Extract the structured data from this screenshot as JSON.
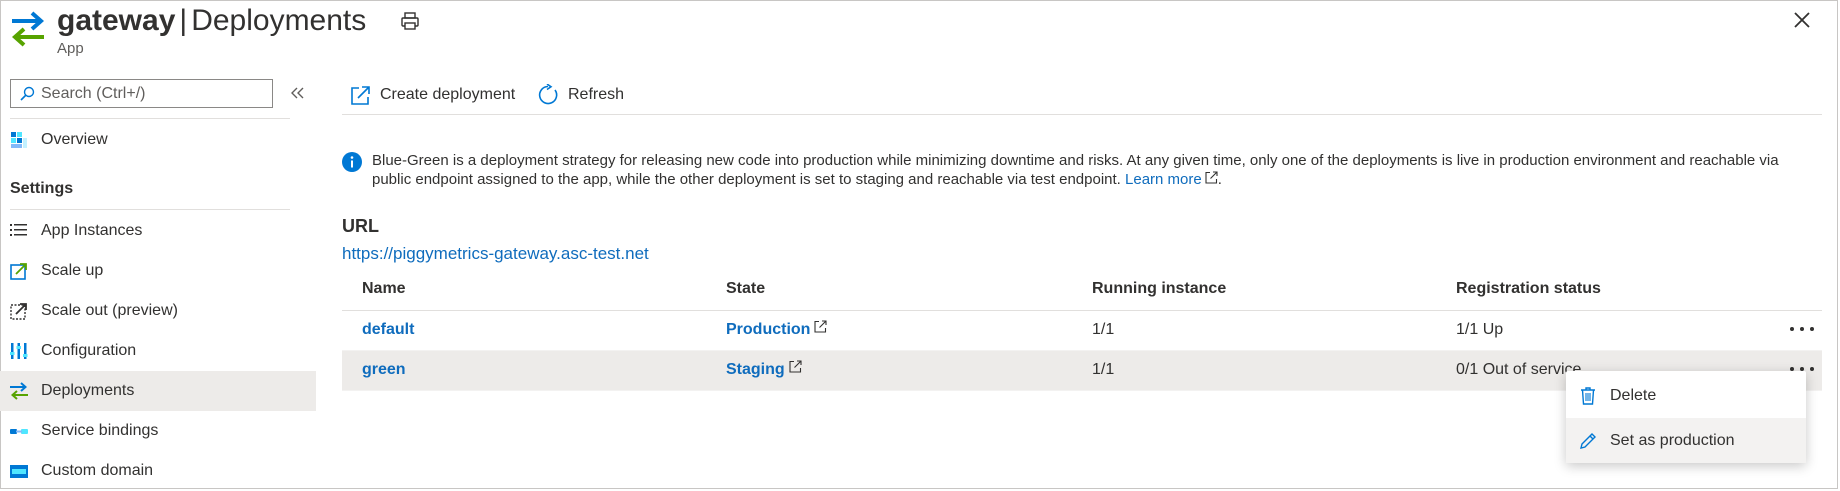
{
  "header": {
    "app_name": "gateway",
    "separator": "|",
    "page": "Deployments",
    "subtitle": "App"
  },
  "search": {
    "placeholder": "Search (Ctrl+/)"
  },
  "sidebar": {
    "items": [
      {
        "label": "Overview",
        "icon": "overview-icon"
      }
    ],
    "section": "Settings",
    "settings_items": [
      {
        "label": "App Instances",
        "icon": "list-icon"
      },
      {
        "label": "Scale up",
        "icon": "scale-up-icon"
      },
      {
        "label": "Scale out (preview)",
        "icon": "scale-out-icon"
      },
      {
        "label": "Configuration",
        "icon": "configuration-icon"
      },
      {
        "label": "Deployments",
        "icon": "deployments-icon",
        "active": true
      },
      {
        "label": "Service bindings",
        "icon": "service-bindings-icon"
      },
      {
        "label": "Custom domain",
        "icon": "custom-domain-icon"
      }
    ]
  },
  "toolbar": {
    "create_label": "Create deployment",
    "refresh_label": "Refresh"
  },
  "info": {
    "text": "Blue-Green is a deployment strategy for releasing new code into production while minimizing downtime and risks. At any given time, only one of the deployments is live in production environment and reachable via public endpoint assigned to the app, while the other deployment is set to staging and reachable via test endpoint.",
    "link": "Learn more",
    "suffix": "."
  },
  "url_section": {
    "heading": "URL",
    "link": "https://piggymetrics-gateway.asc-test.net"
  },
  "table": {
    "columns": [
      "Name",
      "State",
      "Running instance",
      "Registration status"
    ],
    "rows": [
      {
        "name": "default",
        "state": "Production",
        "running": "1/1",
        "registration": "1/1 Up"
      },
      {
        "name": "green",
        "state": "Staging",
        "running": "1/1",
        "registration": "0/1 Out of service"
      }
    ]
  },
  "context_menu": {
    "items": [
      {
        "label": "Delete",
        "icon": "trash-icon"
      },
      {
        "label": "Set as production",
        "icon": "pencil-icon"
      }
    ]
  },
  "colors": {
    "link": "#0f6cbd",
    "active_bg": "#edebe9",
    "arrow_blue": "#0078d4",
    "arrow_green": "#57a300"
  }
}
